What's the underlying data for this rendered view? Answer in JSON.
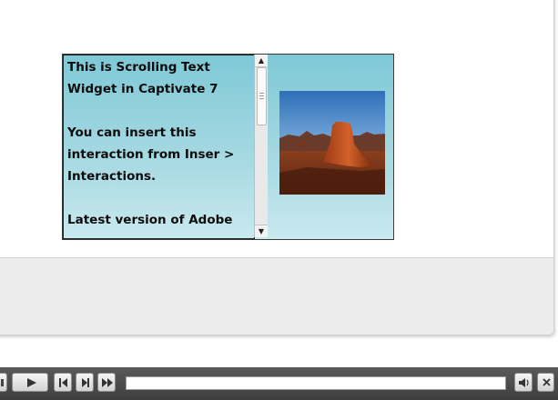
{
  "slide": {
    "scrolling_text": {
      "paragraphs": [
        "This is Scrolling Text Widget in Captivate 7",
        "You can insert this interaction from Inser > Interactions.",
        "Latest version of Adobe"
      ]
    },
    "image": {
      "name": "desert-butte-photo"
    }
  },
  "playbar": {
    "buttons": [
      {
        "name": "toc-button",
        "icon": "toc-icon"
      },
      {
        "name": "play-button",
        "icon": "play-icon"
      },
      {
        "name": "rewind-button",
        "icon": "rewind-icon"
      },
      {
        "name": "next-slide-button",
        "icon": "next-slide-icon"
      },
      {
        "name": "fast-forward-button",
        "icon": "fast-forward-icon"
      },
      {
        "name": "mute-button",
        "icon": "speaker-icon"
      },
      {
        "name": "close-button",
        "icon": "close-icon"
      }
    ],
    "progress": 0
  }
}
